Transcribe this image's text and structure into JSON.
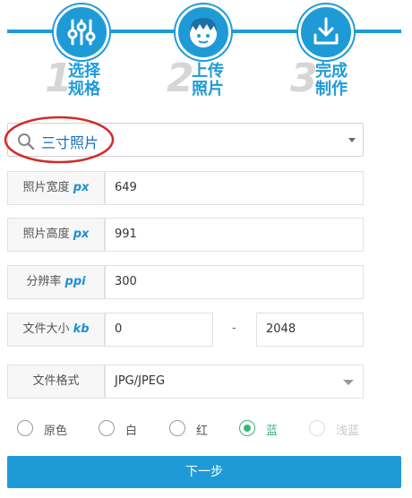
{
  "steps": [
    {
      "number": "1",
      "label": "选择规格",
      "icon": "sliders-icon"
    },
    {
      "number": "2",
      "label": "上传照片",
      "icon": "face-icon"
    },
    {
      "number": "3",
      "label": "完成制作",
      "icon": "download-icon"
    }
  ],
  "spec": {
    "value": "三寸照片",
    "icon": "search-icon"
  },
  "fields": {
    "width": {
      "label": "照片宽度",
      "unit": "px",
      "value": "649"
    },
    "height": {
      "label": "照片高度",
      "unit": "px",
      "value": "991"
    },
    "dpi": {
      "label": "分辨率",
      "unit": "ppi",
      "value": "300"
    },
    "filesize": {
      "label": "文件大小",
      "unit": "kb",
      "min": "0",
      "separator": "-",
      "max": "2048"
    },
    "format": {
      "label": "文件格式",
      "value": "JPG/JPEG"
    }
  },
  "background_colors": [
    {
      "label": "原色",
      "checked": false,
      "disabled": false
    },
    {
      "label": "白",
      "checked": false,
      "disabled": false
    },
    {
      "label": "红",
      "checked": false,
      "disabled": false
    },
    {
      "label": "蓝",
      "checked": true,
      "disabled": false
    },
    {
      "label": "浅蓝",
      "checked": false,
      "disabled": true
    }
  ],
  "next_button": {
    "label": "下一步"
  },
  "colors": {
    "accent": "#1e9bd7",
    "selected_radio": "#3bb574",
    "annotation": "#d22b2b"
  }
}
